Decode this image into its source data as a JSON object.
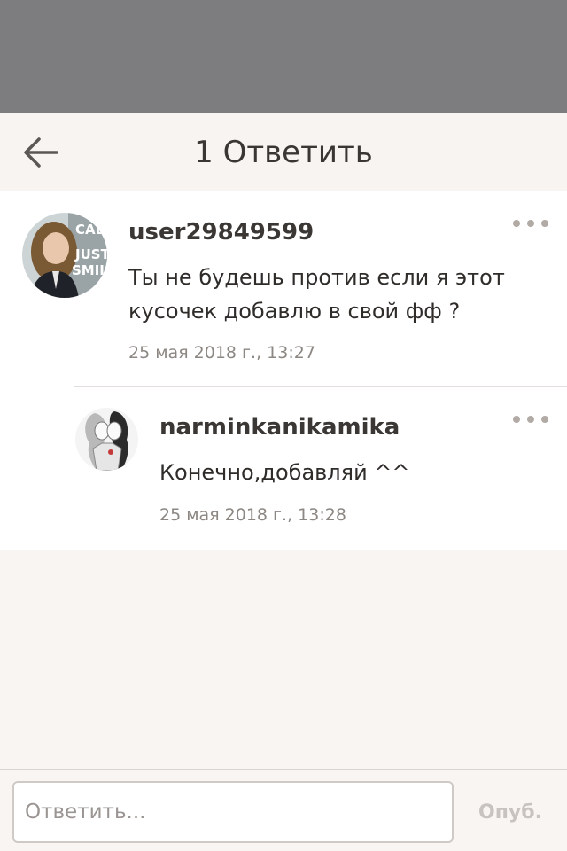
{
  "header": {
    "title": "1 Ответить",
    "back_icon": "arrow-left-icon"
  },
  "comment": {
    "username": "user29849599",
    "text_line1": "Ты не будешь против если я этот",
    "text_line2": "кусочек добавлю в свой фф ?",
    "timestamp": "25 мая 2018 г., 13:27",
    "avatar_text": [
      "CAL",
      "JUST",
      "SMILE"
    ],
    "more_icon": "more-horizontal-icon"
  },
  "reply": {
    "username": "narminkanikamika",
    "text": "Конечно,добавляй ^^",
    "timestamp": "25 мая 2018 г., 13:28",
    "more_icon": "more-horizontal-icon"
  },
  "composer": {
    "placeholder": "Ответить...",
    "post_label": "Опуб."
  },
  "colors": {
    "overlay": "#7d7c7e",
    "header_bg": "#f8f4f1",
    "page_bg": "#f8f5f3",
    "card_bg": "#ffffff",
    "muted_text": "#8c8783",
    "disabled_button": "#c8c3c0"
  }
}
